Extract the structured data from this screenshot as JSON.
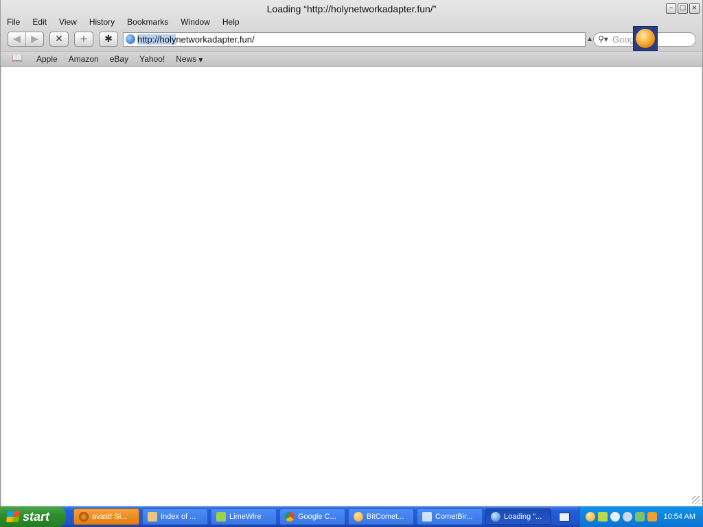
{
  "window": {
    "title": "Loading “http://holynetworkadapter.fun/”",
    "buttons": [
      "minimize",
      "maximize",
      "close"
    ]
  },
  "menu": [
    "File",
    "Edit",
    "View",
    "History",
    "Bookmarks",
    "Window",
    "Help"
  ],
  "toolbar": {
    "url_selected": "http://holy",
    "url_rest": "networkadapter.fun/",
    "search_placeholder": "Google"
  },
  "bookmarks": {
    "items": [
      "Apple",
      "Amazon",
      "eBay",
      "Yahoo!",
      "News"
    ]
  },
  "taskbar": {
    "start_label": "start",
    "tasks": [
      {
        "label": "avast! Si...",
        "icon": "avast-icon",
        "state": "alert"
      },
      {
        "label": "Index of ...",
        "icon": "folder-icon",
        "state": "normal"
      },
      {
        "label": "LimeWire",
        "icon": "limewire-icon",
        "state": "normal"
      },
      {
        "label": "Google C...",
        "icon": "chrome-icon",
        "state": "normal"
      },
      {
        "label": "BitComet...",
        "icon": "bitcomet-icon",
        "state": "normal"
      },
      {
        "label": "CometBir...",
        "icon": "cometbird-icon",
        "state": "normal"
      },
      {
        "label": "Loading \"...",
        "icon": "safari-icon",
        "state": "active"
      }
    ],
    "clock": "10:54 AM"
  },
  "colors": {
    "taskbar_blue": "#245edb",
    "start_green": "#2e8f2e",
    "url_selection": "#b6d1f2"
  }
}
